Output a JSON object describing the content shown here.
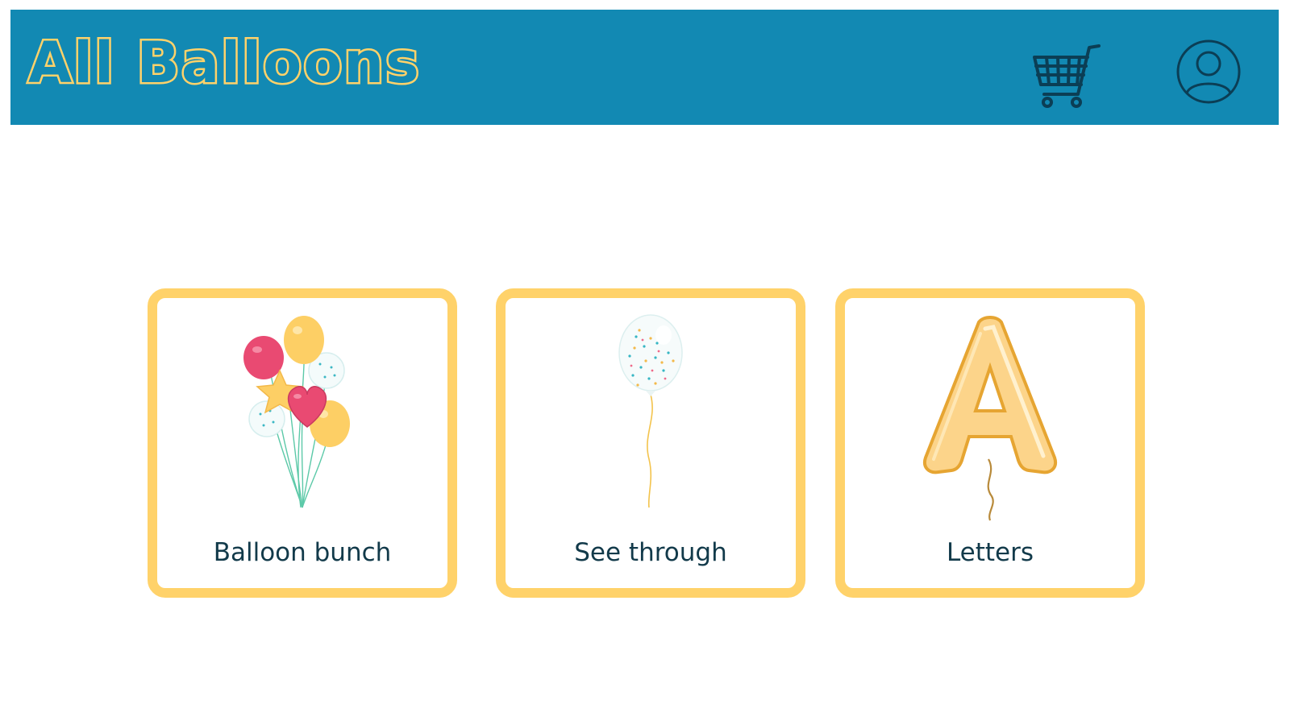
{
  "header": {
    "logo_text": "All Balloons",
    "background_color": "#1289b3",
    "logo_color": "#ffd26a",
    "icons": {
      "cart": "shopping-cart-icon",
      "account": "user-account-icon"
    }
  },
  "categories": [
    {
      "label": "Balloon bunch",
      "image": "balloon-bunch-image"
    },
    {
      "label": "See through",
      "image": "see-through-balloon-image"
    },
    {
      "label": "Letters",
      "image": "letter-balloon-image"
    }
  ],
  "theme": {
    "card_border_color": "#ffd26a",
    "label_color": "#123a4a"
  }
}
